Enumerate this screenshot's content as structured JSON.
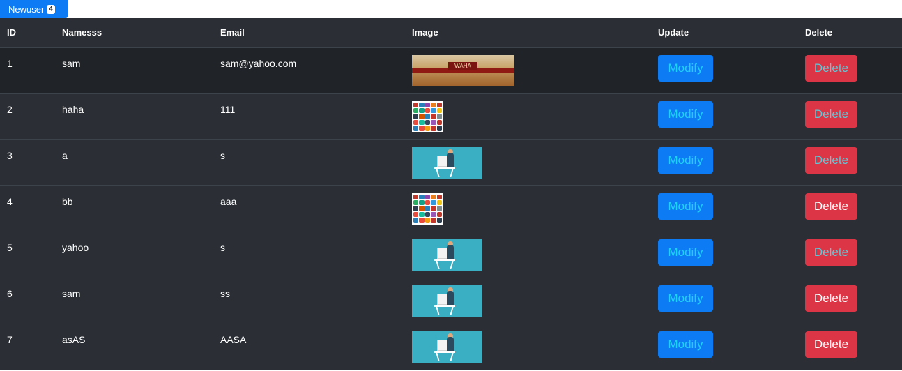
{
  "header": {
    "newuser_label": "Newuser",
    "newuser_count": "4"
  },
  "table": {
    "columns": [
      "ID",
      "Namesss",
      "Email",
      "Image",
      "Update",
      "Delete"
    ],
    "rows": [
      {
        "id": "1",
        "name": "sam",
        "email": "sam@yahoo.com",
        "image": "store-sign-thumbnail",
        "update": "Modify",
        "delete": "Delete"
      },
      {
        "id": "2",
        "name": "haha",
        "email": "111",
        "image": "logo-collage-thumbnail",
        "update": "Modify",
        "delete": "Delete"
      },
      {
        "id": "3",
        "name": "a",
        "email": "s",
        "image": "desk-worker-thumbnail",
        "update": "Modify",
        "delete": "Delete"
      },
      {
        "id": "4",
        "name": "bb",
        "email": "aaa",
        "image": "logo-collage-thumbnail",
        "update": "Modify",
        "delete": "Delete"
      },
      {
        "id": "5",
        "name": "yahoo",
        "email": "s",
        "image": "desk-worker-thumbnail",
        "update": "Modify",
        "delete": "Delete"
      },
      {
        "id": "6",
        "name": "sam",
        "email": "ss",
        "image": "desk-worker-thumbnail",
        "update": "Modify",
        "delete": "Delete"
      },
      {
        "id": "7",
        "name": "asAS",
        "email": "AASA",
        "image": "desk-worker-thumbnail",
        "update": "Modify",
        "delete": "Delete"
      }
    ]
  },
  "colors": {
    "primary": "#0d7bf3",
    "danger": "#dc3545",
    "table_bg": "#2b2f35",
    "hover_row": "#202327"
  }
}
